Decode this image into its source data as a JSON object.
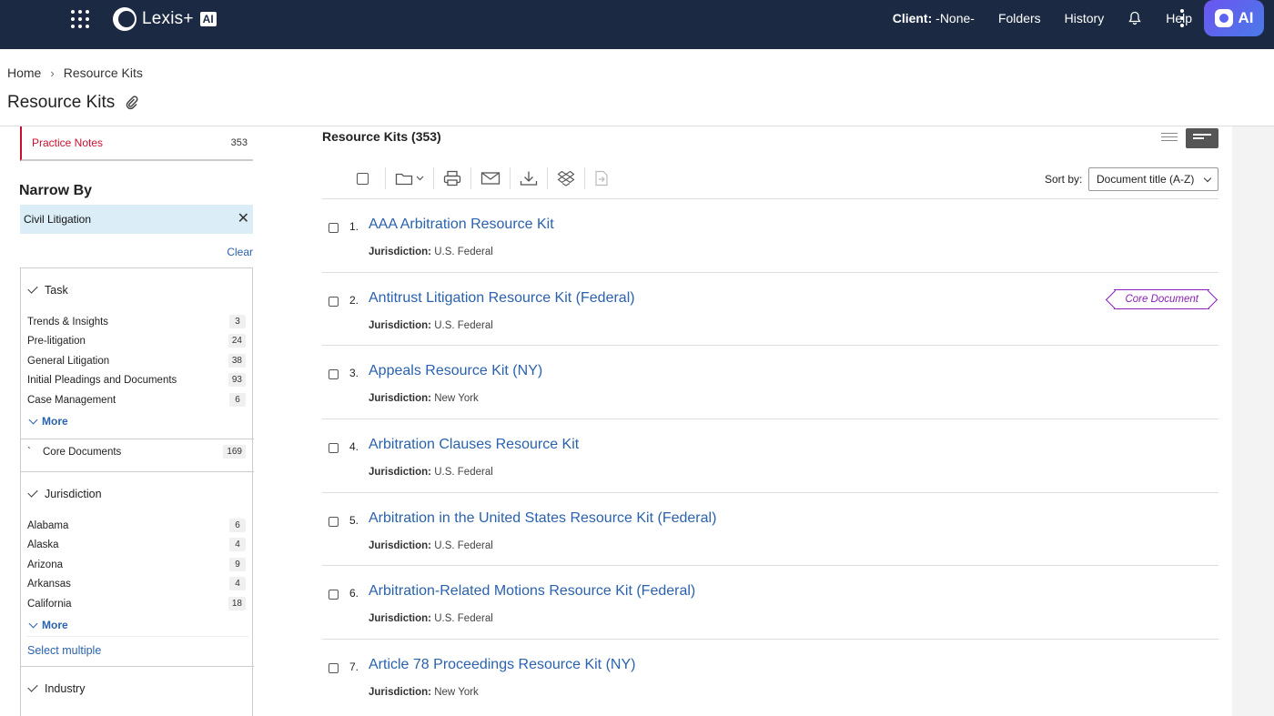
{
  "header": {
    "logo_text": "Lexis+",
    "logo_ai": "AI",
    "client_label": "Client:",
    "client_value": "-None-",
    "folders": "Folders",
    "history": "History",
    "help": "Help",
    "ai_button": "AI"
  },
  "breadcrumb": {
    "home": "Home",
    "current": "Resource Kits"
  },
  "page_title": "Resource Kits",
  "sidebar": {
    "practice_notes": {
      "label": "Practice Notes",
      "count": "353"
    },
    "narrow_by": "Narrow By",
    "active_filter": "Civil Litigation",
    "clear": "Clear",
    "task": {
      "label": "Task",
      "items": [
        {
          "label": "Trends & Insights",
          "count": "3"
        },
        {
          "label": "Pre-litigation",
          "count": "24"
        },
        {
          "label": "General Litigation",
          "count": "38"
        },
        {
          "label": "Initial Pleadings and Documents",
          "count": "93"
        },
        {
          "label": "Case Management",
          "count": "6"
        }
      ],
      "more": "More"
    },
    "core_documents": {
      "label": "Core Documents",
      "count": "169"
    },
    "jurisdiction": {
      "label": "Jurisdiction",
      "items": [
        {
          "label": "Alabama",
          "count": "6"
        },
        {
          "label": "Alaska",
          "count": "4"
        },
        {
          "label": "Arizona",
          "count": "9"
        },
        {
          "label": "Arkansas",
          "count": "4"
        },
        {
          "label": "California",
          "count": "18"
        }
      ],
      "more": "More",
      "select_multiple": "Select multiple"
    },
    "industry": {
      "label": "Industry"
    }
  },
  "main": {
    "results_title": "Resource Kits (353)",
    "sort_label": "Sort by:",
    "sort_value": "Document title (A-Z)",
    "jurisdiction_label": "Jurisdiction:",
    "core_tag": "Core Document",
    "results": [
      {
        "num": "1.",
        "title": "AAA Arbitration Resource Kit",
        "jurisdiction": "U.S. Federal"
      },
      {
        "num": "2.",
        "title": "Antitrust Litigation Resource Kit (Federal)",
        "jurisdiction": "U.S. Federal"
      },
      {
        "num": "3.",
        "title": "Appeals Resource Kit (NY)",
        "jurisdiction": "New York"
      },
      {
        "num": "4.",
        "title": "Arbitration Clauses Resource Kit",
        "jurisdiction": "U.S. Federal"
      },
      {
        "num": "5.",
        "title": "Arbitration in the United States Resource Kit (Federal)",
        "jurisdiction": "U.S. Federal"
      },
      {
        "num": "6.",
        "title": "Arbitration-Related Motions Resource Kit (Federal)",
        "jurisdiction": "U.S. Federal"
      },
      {
        "num": "7.",
        "title": "Article 78 Proceedings Resource Kit (NY)",
        "jurisdiction": "New York"
      }
    ]
  }
}
